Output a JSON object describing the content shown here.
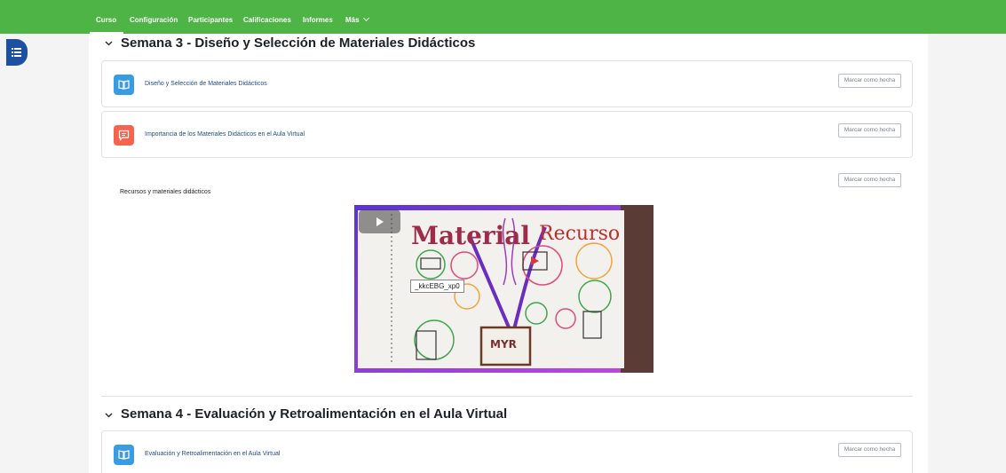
{
  "nav": {
    "tabs": [
      {
        "label": "Curso",
        "active": true
      },
      {
        "label": "Configuración",
        "active": false
      },
      {
        "label": "Participantes",
        "active": false
      },
      {
        "label": "Calificaciones",
        "active": false
      },
      {
        "label": "Informes",
        "active": false
      },
      {
        "label": "Más",
        "active": false
      }
    ],
    "more_chevron": "⌄"
  },
  "drawer": {
    "icon": "list-icon"
  },
  "sections": [
    {
      "title": "Semana 3 - Diseño y Selección de Materiales Didácticos",
      "collapse_icon": "chevron-down-icon",
      "activities": [
        {
          "name": "Diseño y Selección de Materiales Didácticos",
          "icon": "book-icon",
          "icon_color": "#399be2",
          "completion": "Marcar como hecha"
        },
        {
          "name": "Importancia de los Materiales Didácticos en el Aula Virtual",
          "icon": "forum-icon",
          "icon_color": "#f7634d",
          "completion": "Marcar como hecha"
        }
      ],
      "label": {
        "text": "Recursos y materiales didácticos",
        "completion": "Marcar como hecha",
        "video": {
          "tooltip": "_kkcEBG_xp0",
          "words": [
            "Material",
            "Recurso",
            "MYR"
          ]
        }
      }
    },
    {
      "title": "Semana 4 - Evaluación y Retroalimentación en el Aula Virtual",
      "collapse_icon": "chevron-down-icon",
      "activities": [
        {
          "name": "Evaluación y Retroalimentación en el Aula Virtual",
          "icon": "book-icon",
          "icon_color": "#399be2",
          "completion": "Marcar como hecha"
        }
      ]
    }
  ],
  "colors": {
    "navbar": "#4db445",
    "drawer": "#1e50a2",
    "link": "#1d4b8a"
  }
}
